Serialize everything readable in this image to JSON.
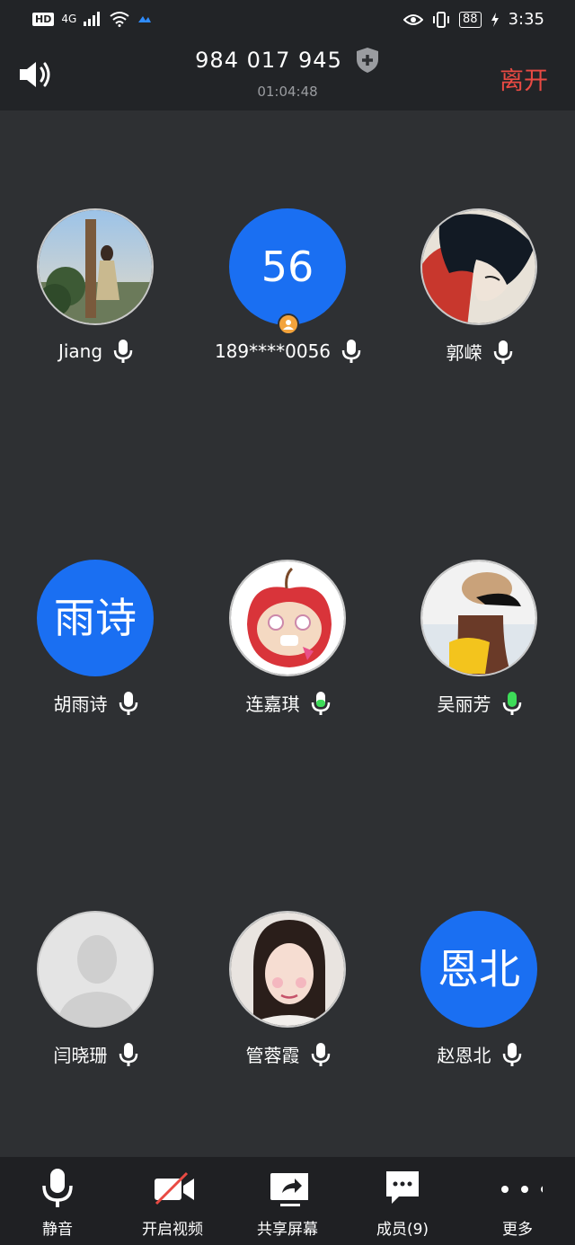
{
  "status_bar": {
    "hd": "HD",
    "network": "4G",
    "battery": "88",
    "time": "3:35"
  },
  "header": {
    "meeting_id": "984 017 945",
    "duration": "01:04:48",
    "leave_label": "离开",
    "leave_color": "#e94a43"
  },
  "participants": [
    {
      "name": "Jiang",
      "avatar_type": "photo",
      "avatar_text": ""
    },
    {
      "name": "189****0056",
      "avatar_type": "text",
      "avatar_text": "56",
      "is_host": true
    },
    {
      "name": "郭嵘",
      "avatar_type": "photo",
      "avatar_text": ""
    },
    {
      "name": "胡雨诗",
      "avatar_type": "text",
      "avatar_text": "雨诗"
    },
    {
      "name": "连嘉琪",
      "avatar_type": "photo",
      "avatar_text": "",
      "speaking": true
    },
    {
      "name": "吴丽芳",
      "avatar_type": "photo",
      "avatar_text": "",
      "speaking": true
    },
    {
      "name": "闫晓珊",
      "avatar_type": "placeholder",
      "avatar_text": ""
    },
    {
      "name": "管蓉霞",
      "avatar_type": "photo",
      "avatar_text": ""
    },
    {
      "name": "赵恩北",
      "avatar_type": "text",
      "avatar_text": "恩北"
    }
  ],
  "toolbar": {
    "mute_label": "静音",
    "video_label": "开启视频",
    "share_label": "共享屏幕",
    "members_label": "成员(9)",
    "more_label": "更多"
  },
  "colors": {
    "accent_blue": "#1a6ff2",
    "speaking_green": "#3ddc58",
    "background": "#2e3033"
  }
}
